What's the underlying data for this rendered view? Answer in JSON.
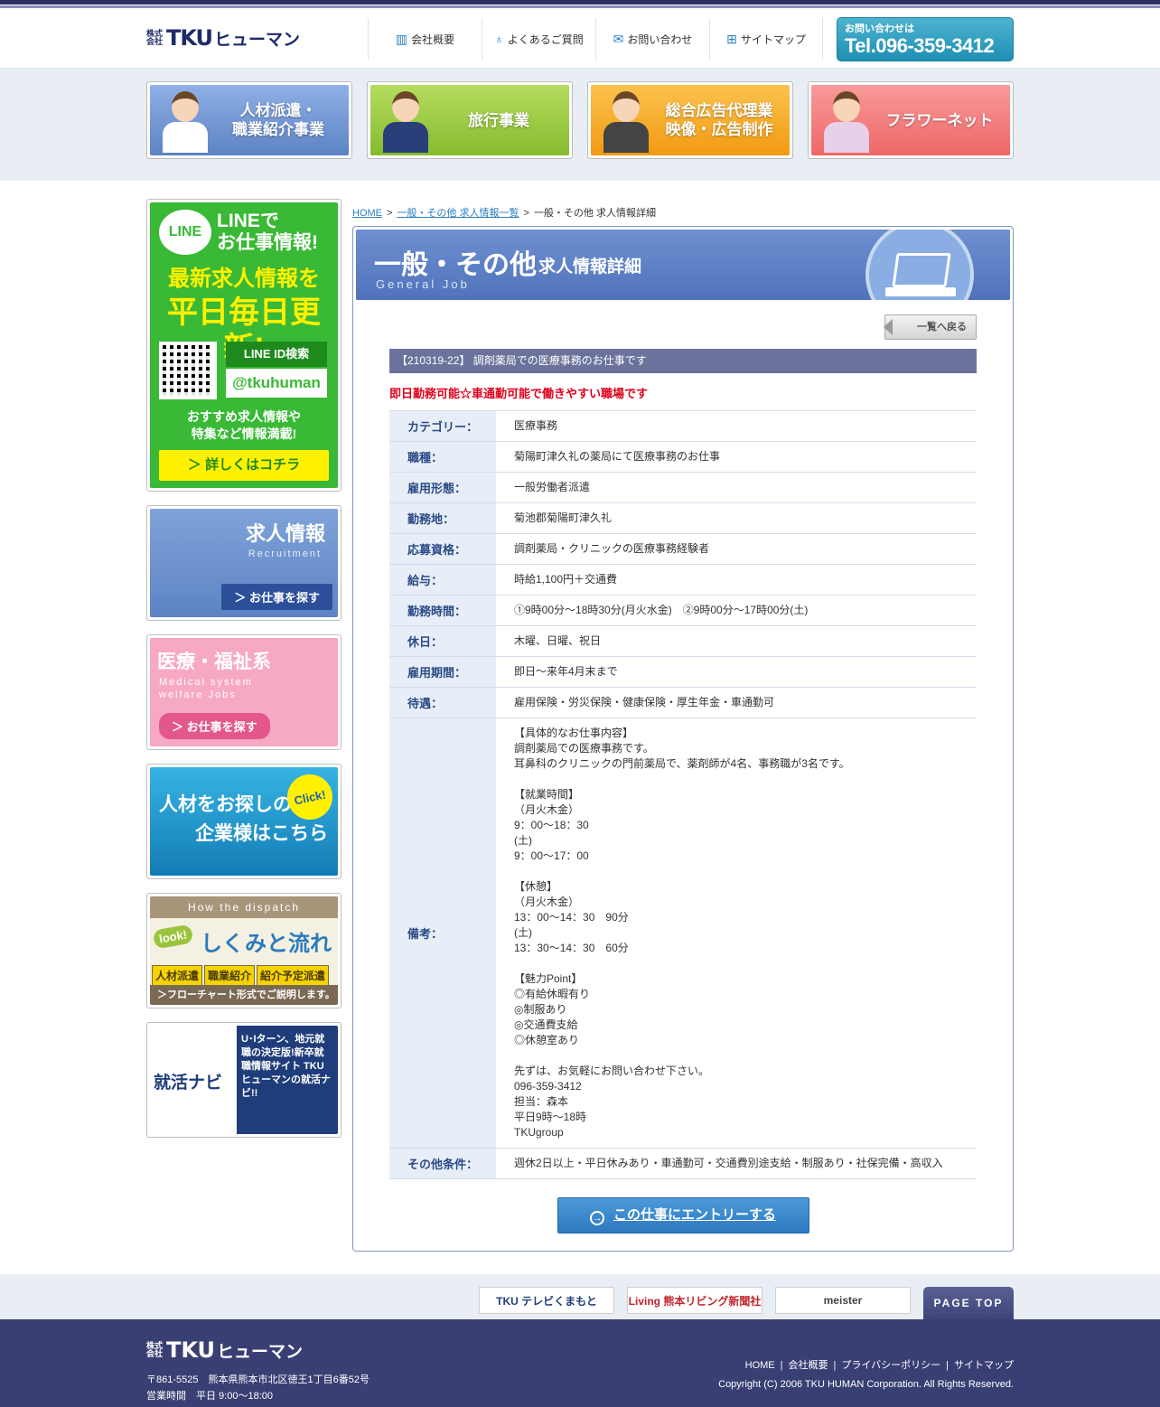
{
  "header": {
    "logo": {
      "kabushiki": "株式会社",
      "tku": "TKU",
      "human": "ヒューマン"
    },
    "nav": [
      {
        "label": "会社概要",
        "icon": "building-icon"
      },
      {
        "label": "よくあるご質問",
        "icon": "lightbulb-icon"
      },
      {
        "label": "お問い合わせ",
        "icon": "mail-icon"
      },
      {
        "label": "サイトマップ",
        "icon": "sitemap-icon"
      }
    ],
    "tel_caption": "お問い合わせは",
    "tel": "Tel.096-359-3412"
  },
  "business": [
    {
      "label1": "人材派遣・",
      "label2": "職業紹介事業",
      "color": "#6f93d3"
    },
    {
      "label1": "旅行事業",
      "label2": "",
      "color": "#9acb3d"
    },
    {
      "label1": "総合広告代理業",
      "label2": "映像・広告制作",
      "color": "#f6a51c"
    },
    {
      "label1": "フラワーネット",
      "label2": "",
      "color": "#f27c7c"
    }
  ],
  "sidebar": {
    "line": {
      "logo": "LINE",
      "title1": "LINEで",
      "title2": "お仕事情報!",
      "h2": "最新求人情報を",
      "h3": "平日毎日更新!",
      "lid": "LINE ID検索",
      "lid_value": "@tkuhuman",
      "desc1": "おすすめ求人情報や",
      "desc2": "特集など情報満載!",
      "more": "詳しくはコチラ"
    },
    "recruit": {
      "title": "求人情報",
      "sub": "Recruitment",
      "btn": "お仕事を探す"
    },
    "medical": {
      "title": "医療・福祉系",
      "sub1": "Medical system",
      "sub2": "welfare Jobs",
      "btn": "お仕事を探す"
    },
    "enterprise": {
      "line1": "人材をお探しの",
      "line2": "企業様はこちら",
      "click": "Click!"
    },
    "how": {
      "title": "How the dispatch",
      "look": "look!",
      "main": "しくみと流れ",
      "tags": [
        "人材派遣",
        "職業紹介",
        "紹介予定派遣"
      ],
      "foot": "フローチャート形式でご説明します。"
    },
    "navi": {
      "logo": "就活ナビ",
      "text": "U･Iターン、地元就職の決定版!新卒就職情報サイト TKUヒューマンの就活ナビ!!"
    }
  },
  "breadcrumb": {
    "home": "HOME",
    "list": "一般・その他 求人情報一覧",
    "current": "一般・その他 求人情報詳細",
    "sep": ">"
  },
  "panel": {
    "title": "一般・その他",
    "subtitle": "求人情報詳細",
    "english": "General Job",
    "back": "一覧へ戻る",
    "job_bar": "【210319-22】 調剤薬局での医療事務のお仕事です",
    "catch": "即日勤務可能☆車通勤可能で働きやすい職場です",
    "rows": [
      {
        "th": "カテゴリー：",
        "td": "医療事務"
      },
      {
        "th": "職種：",
        "td": "菊陽町津久礼の薬局にて医療事務のお仕事"
      },
      {
        "th": "雇用形態：",
        "td": "一般労働者派遣"
      },
      {
        "th": "勤務地：",
        "td": "菊池郡菊陽町津久礼"
      },
      {
        "th": "応募資格：",
        "td": "調剤薬局・クリニックの医療事務経験者"
      },
      {
        "th": "給与：",
        "td": "時給1,100円＋交通費"
      },
      {
        "th": "勤務時間：",
        "td": "①9時00分〜18時30分(月火水金)　②9時00分〜17時00分(土)"
      },
      {
        "th": "休日：",
        "td": "木曜、日曜、祝日"
      },
      {
        "th": "雇用期間：",
        "td": "即日～来年4月末まで"
      },
      {
        "th": "待遇：",
        "td": "雇用保険・労災保険・健康保険・厚生年金・車通勤可"
      },
      {
        "th": "備考：",
        "td": "【具体的なお仕事内容】\n調剤薬局での医療事務です。\n耳鼻科のクリニックの門前薬局で、薬剤師が4名、事務職が3名です。\n\n【就業時間】\n（月火木金）\n9：00～18：30\n(土)\n9：00～17：00\n\n【休憩】\n（月火木金）\n13：00～14：30　90分\n(土)\n13：30～14：30　60分\n\n【魅力Point】\n◎有給休暇有り\n◎制服あり\n◎交通費支給\n◎休憩室あり\n\n先ずは、お気軽にお問い合わせ下さい。\n096-359-3412\n担当：森本\n平日9時～18時\nTKUgroup"
      },
      {
        "th": "その他条件：",
        "td": "週休2日以上・平日休みあり・車通勤可・交通費別途支給・制服あり・社保完備・高収入"
      }
    ],
    "entry": "この仕事にエントリーする"
  },
  "partners": [
    {
      "label": "TKU テレビくまもと",
      "color": "#1f3d7a"
    },
    {
      "label": "Living 熊本リビング新聞社",
      "color": "#c0262d"
    },
    {
      "label": "meister",
      "color": "#444"
    }
  ],
  "pagetop": "PAGE TOP",
  "footer": {
    "address": "〒861-5525　熊本県熊本市北区徳王1丁目6番52号",
    "hours": "営業時間　平日 9:00～18:00",
    "links": [
      "HOME",
      "会社概要",
      "プライバシーポリシー",
      "サイトマップ"
    ],
    "copyright": "Copyright (C) 2006 TKU HUMAN Corporation. All Rights Reserved."
  }
}
